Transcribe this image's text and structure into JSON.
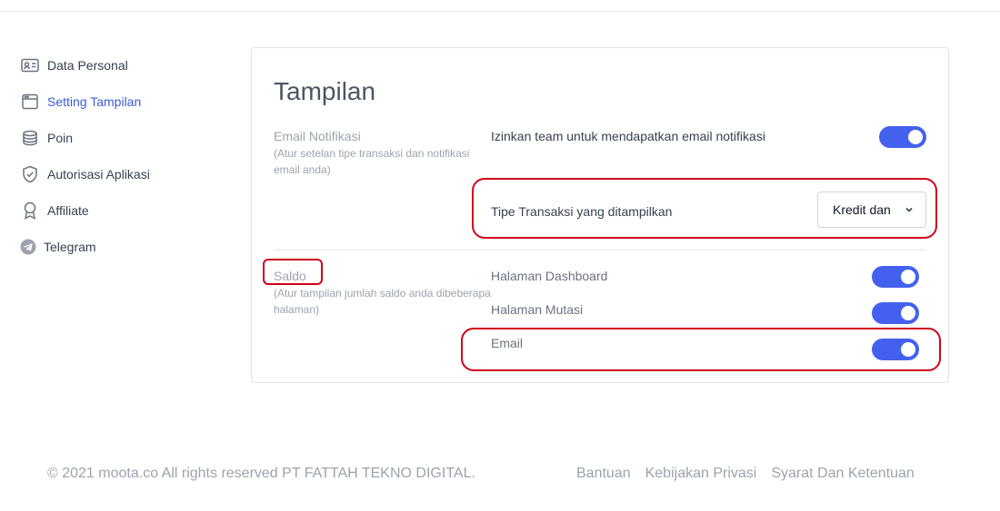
{
  "sidebar": {
    "items": [
      {
        "label": "Data Personal",
        "icon": "id-card-icon"
      },
      {
        "label": "Setting Tampilan",
        "icon": "browser-window-icon",
        "active": true
      },
      {
        "label": "Poin",
        "icon": "database-icon"
      },
      {
        "label": "Autorisasi Aplikasi",
        "icon": "shield-check-icon"
      },
      {
        "label": "Affiliate",
        "icon": "badge-icon"
      },
      {
        "label": "Telegram",
        "icon": "telegram-icon"
      }
    ]
  },
  "card": {
    "title": "Tampilan",
    "email_section": {
      "title": "Email Notifikasi",
      "description": "(Atur setelan tipe transaksi dan notifikasi email anda)",
      "toggle_label": "Izinkan team untuk mendapatkan email notifikasi",
      "toggle_on": true,
      "transaction_label": "Tipe Transaksi yang ditampilkan",
      "transaction_value": "Kredit dan"
    },
    "saldo_section": {
      "title": "Saldo",
      "description": "(Atur tampilan jumlah saldo anda dibeberapa halaman)",
      "items": [
        {
          "label": "Halaman Dashboard",
          "on": true
        },
        {
          "label": "Halaman Mutasi",
          "on": true
        },
        {
          "label": "Email",
          "on": true
        }
      ]
    }
  },
  "footer": {
    "copyright": "© 2021 moota.co All rights reserved PT FATTAH TEKNO DIGITAL.",
    "links": [
      "Bantuan",
      "Kebijakan Privasi",
      "Syarat Dan Ketentuan"
    ]
  },
  "colors": {
    "accent": "#4361ee",
    "active_link": "#3b5bdb",
    "highlight": "#d0021b"
  }
}
